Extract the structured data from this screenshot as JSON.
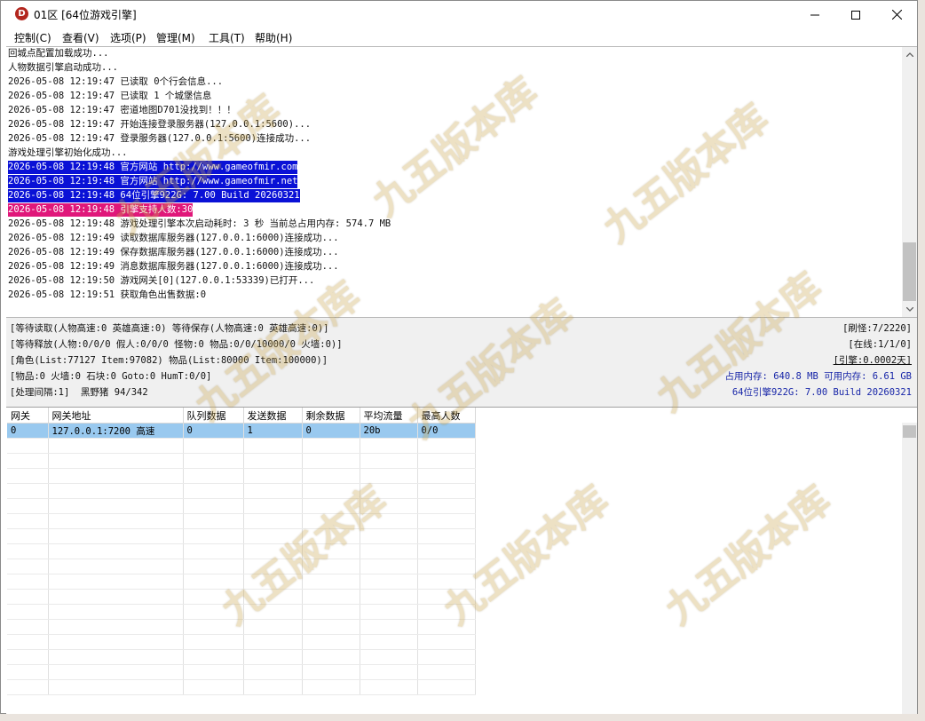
{
  "window": {
    "title": "01区 [64位游戏引擎]"
  },
  "menu": [
    {
      "label": "控制(C)"
    },
    {
      "label": "查看(V)"
    },
    {
      "label": "选项(P)"
    },
    {
      "label": "管理(M)"
    },
    {
      "label": "工具(T)"
    },
    {
      "label": "帮助(H)"
    }
  ],
  "log": [
    {
      "text": "回城点配置加载成功..."
    },
    {
      "text": "人物数据引擎启动成功..."
    },
    {
      "text": "2026-05-08 12:19:47 已读取 0个行会信息..."
    },
    {
      "text": "2026-05-08 12:19:47 已读取 1 个城堡信息"
    },
    {
      "text": "2026-05-08 12:19:47 密道地图D701没找到！！！"
    },
    {
      "text": "2026-05-08 12:19:47 开始连接登录服务器(127.0.0.1:5600)..."
    },
    {
      "text": "2026-05-08 12:19:47 登录服务器(127.0.0.1:5600)连接成功..."
    },
    {
      "text": "游戏处理引擎初始化成功..."
    },
    {
      "text": "2026-05-08 12:19:48 官方网站 http://www.gameofmir.com"
    },
    {
      "text": "2026-05-08 12:19:48 官方网站 http://www.gameofmir.net"
    },
    {
      "text": "2026-05-08 12:19:48 64位引擎922G: 7.00 Build 20260321"
    },
    {
      "text": "2026-05-08 12:19:48 引擎支持人数:30"
    },
    {
      "text": "2026-05-08 12:19:48 游戏处理引擎本次启动耗时: 3 秒 当前总占用内存: 574.7 MB"
    },
    {
      "text": "2026-05-08 12:19:49 读取数据库服务器(127.0.0.1:6000)连接成功..."
    },
    {
      "text": "2026-05-08 12:19:49 保存数据库服务器(127.0.0.1:6000)连接成功..."
    },
    {
      "text": "2026-05-08 12:19:49 消息数据库服务器(127.0.0.1:6000)连接成功..."
    },
    {
      "text": "2026-05-08 12:19:50 游戏网关[0](127.0.0.1:53339)已打开..."
    },
    {
      "text": "2026-05-08 12:19:51 获取角色出售数据:0"
    }
  ],
  "status": {
    "left": [
      "[等待读取(人物高速:0 英雄高速:0) 等待保存(人物高速:0 英雄高速:0)]",
      "[等待释放(人物:0/0/0 假人:0/0/0 怪物:0 物品:0/0/10000/0 火墙:0)]",
      "[角色(List:77127 Item:97082) 物品(List:80000 Item:100000)]",
      "[物品:0 火墙:0 石块:0 Goto:0 HumT:0/0]",
      "[处理间隔:1]  黑野猪 94/342"
    ],
    "right": {
      "refresh": "[刷怪:7/2220]",
      "online": "[在线:1/1/0]",
      "engine": "[引擎:0.0002天]",
      "memory": "占用内存: 640.8 MB 可用内存: 6.61 GB",
      "build": "64位引擎922G: 7.00 Build 20260321"
    }
  },
  "gateway": {
    "columns": [
      "网关",
      "网关地址",
      "队列数据",
      "发送数据",
      "剩余数据",
      "平均流量",
      "最高人数"
    ],
    "rows": [
      [
        "0",
        "127.0.0.1:7200 高速",
        "0",
        "1",
        "0",
        "20b",
        "0/0"
      ]
    ]
  },
  "watermark": "九五版本库",
  "colors": {
    "highlight_blue": "#0a11d6",
    "highlight_pink": "#e0177a",
    "selected_row": "#99c9ef",
    "status_blue": "#1826a8"
  }
}
